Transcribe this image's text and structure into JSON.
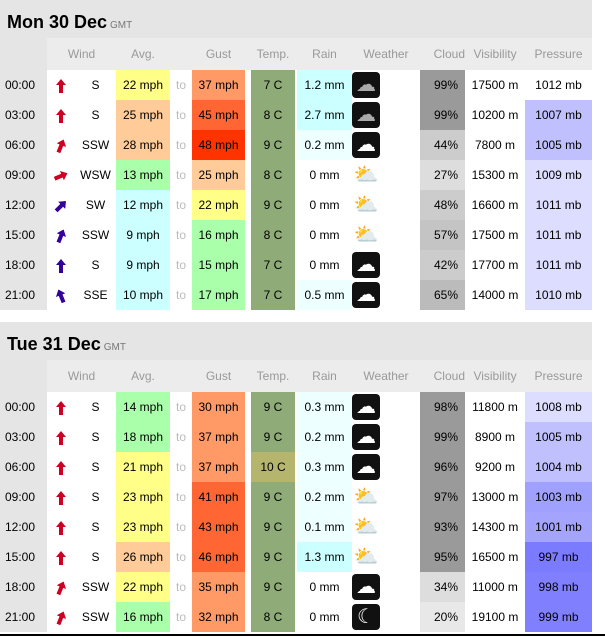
{
  "columns": {
    "wind": "Wind",
    "avg": "Avg.",
    "gust": "Gust",
    "temp": "Temp.",
    "rain": "Rain",
    "weather": "Weather",
    "cloud": "Cloud",
    "visibility": "Visibility",
    "pressure": "Pressure"
  },
  "to_label": "to",
  "days": [
    {
      "title": "Mon 30 Dec",
      "tz": "GMT",
      "rows": [
        {
          "time": "00:00",
          "dir": "S",
          "arrow_color": "#cc0022",
          "avg": "22 mph",
          "avg_color": "#ffff88",
          "gust": "37 mph",
          "gust_color": "#ff9966",
          "temp": "7 C",
          "temp_color": "#8fac78",
          "rain": "1.2 mm",
          "rain_color": "#ccffff",
          "weather": "cloud-rain-icon",
          "cloud": "99%",
          "cloud_color": "#9a9a9a",
          "vis": "17500 m",
          "pres": "1012 mb",
          "pres_color": "#ffffff"
        },
        {
          "time": "03:00",
          "dir": "S",
          "arrow_color": "#cc0022",
          "avg": "25 mph",
          "avg_color": "#ffcc99",
          "gust": "45 mph",
          "gust_color": "#ff6633",
          "temp": "8 C",
          "temp_color": "#8fac78",
          "rain": "2.7 mm",
          "rain_color": "#ccffff",
          "weather": "cloud-rain-icon",
          "cloud": "99%",
          "cloud_color": "#9a9a9a",
          "vis": "10200 m",
          "pres": "1007 mb",
          "pres_color": "#c0c0ff"
        },
        {
          "time": "06:00",
          "dir": "SSW",
          "arrow_color": "#cc0022",
          "avg": "28 mph",
          "avg_color": "#ffcc99",
          "gust": "48 mph",
          "gust_color": "#ff3300",
          "temp": "9 C",
          "temp_color": "#8fac78",
          "rain": "0.2 mm",
          "rain_color": "#eeffff",
          "weather": "cloud-night-icon",
          "cloud": "44%",
          "cloud_color": "#cccccc",
          "vis": "7800 m",
          "pres": "1005 mb",
          "pres_color": "#c0c0ff"
        },
        {
          "time": "09:00",
          "dir": "WSW",
          "arrow_color": "#cc0022",
          "avg": "13 mph",
          "avg_color": "#aaffaa",
          "gust": "25 mph",
          "gust_color": "#ffcc99",
          "temp": "8 C",
          "temp_color": "#8fac78",
          "rain": "0 mm",
          "rain_color": "#ffffff",
          "weather": "cloud-sun-icon",
          "cloud": "27%",
          "cloud_color": "#dddddd",
          "vis": "15300 m",
          "pres": "1009 mb",
          "pres_color": "#ddddff"
        },
        {
          "time": "12:00",
          "dir": "SW",
          "arrow_color": "#330099",
          "avg": "12 mph",
          "avg_color": "#ccffff",
          "gust": "22 mph",
          "gust_color": "#ffff88",
          "temp": "9 C",
          "temp_color": "#8fac78",
          "rain": "0 mm",
          "rain_color": "#ffffff",
          "weather": "cloud-sun-icon",
          "cloud": "48%",
          "cloud_color": "#cccccc",
          "vis": "16600 m",
          "pres": "1011 mb",
          "pres_color": "#ddddff"
        },
        {
          "time": "15:00",
          "dir": "SSW",
          "arrow_color": "#330099",
          "avg": "9 mph",
          "avg_color": "#ccffff",
          "gust": "16 mph",
          "gust_color": "#aaffaa",
          "temp": "8 C",
          "temp_color": "#8fac78",
          "rain": "0 mm",
          "rain_color": "#ffffff",
          "weather": "cloud-sun-icon",
          "cloud": "57%",
          "cloud_color": "#c4c4c4",
          "vis": "17500 m",
          "pres": "1011 mb",
          "pres_color": "#ddddff"
        },
        {
          "time": "18:00",
          "dir": "S",
          "arrow_color": "#330099",
          "avg": "9 mph",
          "avg_color": "#ccffff",
          "gust": "15 mph",
          "gust_color": "#aaffaa",
          "temp": "7 C",
          "temp_color": "#8fac78",
          "rain": "0 mm",
          "rain_color": "#ffffff",
          "weather": "cloud-night-icon",
          "cloud": "42%",
          "cloud_color": "#cccccc",
          "vis": "17700 m",
          "pres": "1011 mb",
          "pres_color": "#ddddff"
        },
        {
          "time": "21:00",
          "dir": "SSE",
          "arrow_color": "#330099",
          "avg": "10 mph",
          "avg_color": "#ccffff",
          "gust": "17 mph",
          "gust_color": "#aaffaa",
          "temp": "7 C",
          "temp_color": "#8fac78",
          "rain": "0.5 mm",
          "rain_color": "#eeffff",
          "weather": "cloud-night-icon",
          "cloud": "65%",
          "cloud_color": "#bbbbbb",
          "vis": "14000 m",
          "pres": "1010 mb",
          "pres_color": "#ddddff"
        }
      ]
    },
    {
      "title": "Tue 31 Dec",
      "tz": "GMT",
      "rows": [
        {
          "time": "00:00",
          "dir": "S",
          "arrow_color": "#cc0022",
          "avg": "14 mph",
          "avg_color": "#aaffaa",
          "gust": "30 mph",
          "gust_color": "#ff9966",
          "temp": "9 C",
          "temp_color": "#8fac78",
          "rain": "0.3 mm",
          "rain_color": "#eeffff",
          "weather": "cloud-night-icon",
          "cloud": "98%",
          "cloud_color": "#9a9a9a",
          "vis": "11800 m",
          "pres": "1008 mb",
          "pres_color": "#ddddff"
        },
        {
          "time": "03:00",
          "dir": "S",
          "arrow_color": "#cc0022",
          "avg": "18 mph",
          "avg_color": "#aaffaa",
          "gust": "37 mph",
          "gust_color": "#ff9966",
          "temp": "9 C",
          "temp_color": "#8fac78",
          "rain": "0.2 mm",
          "rain_color": "#eeffff",
          "weather": "cloud-night-icon",
          "cloud": "99%",
          "cloud_color": "#9a9a9a",
          "vis": "8900 m",
          "pres": "1005 mb",
          "pres_color": "#c0c0ff"
        },
        {
          "time": "06:00",
          "dir": "S",
          "arrow_color": "#cc0022",
          "avg": "21 mph",
          "avg_color": "#ffff88",
          "gust": "37 mph",
          "gust_color": "#ff9966",
          "temp": "10 C",
          "temp_color": "#b5b56e",
          "rain": "0.3 mm",
          "rain_color": "#eeffff",
          "weather": "cloud-night-icon",
          "cloud": "96%",
          "cloud_color": "#9a9a9a",
          "vis": "9200 m",
          "pres": "1004 mb",
          "pres_color": "#c0c0ff"
        },
        {
          "time": "09:00",
          "dir": "S",
          "arrow_color": "#cc0022",
          "avg": "23 mph",
          "avg_color": "#ffff88",
          "gust": "41 mph",
          "gust_color": "#ff6633",
          "temp": "9 C",
          "temp_color": "#8fac78",
          "rain": "0.2 mm",
          "rain_color": "#eeffff",
          "weather": "cloud-sun-icon",
          "cloud": "97%",
          "cloud_color": "#9a9a9a",
          "vis": "13000 m",
          "pres": "1003 mb",
          "pres_color": "#a0a0ff"
        },
        {
          "time": "12:00",
          "dir": "S",
          "arrow_color": "#cc0022",
          "avg": "23 mph",
          "avg_color": "#ffff88",
          "gust": "43 mph",
          "gust_color": "#ff6633",
          "temp": "9 C",
          "temp_color": "#8fac78",
          "rain": "0.1 mm",
          "rain_color": "#eeffff",
          "weather": "cloud-sun-icon",
          "cloud": "93%",
          "cloud_color": "#9a9a9a",
          "vis": "14300 m",
          "pres": "1001 mb",
          "pres_color": "#a4a4ff"
        },
        {
          "time": "15:00",
          "dir": "S",
          "arrow_color": "#cc0022",
          "avg": "26 mph",
          "avg_color": "#ffcc99",
          "gust": "46 mph",
          "gust_color": "#ff6633",
          "temp": "9 C",
          "temp_color": "#8fac78",
          "rain": "1.3 mm",
          "rain_color": "#ccffff",
          "weather": "cloud-sun-rain-icon",
          "cloud": "95%",
          "cloud_color": "#9a9a9a",
          "vis": "16500 m",
          "pres": "997 mb",
          "pres_color": "#7b7bff"
        },
        {
          "time": "18:00",
          "dir": "SSW",
          "arrow_color": "#cc0022",
          "avg": "22 mph",
          "avg_color": "#ffff88",
          "gust": "35 mph",
          "gust_color": "#ff9966",
          "temp": "9 C",
          "temp_color": "#8fac78",
          "rain": "0 mm",
          "rain_color": "#ffffff",
          "weather": "cloud-night-icon",
          "cloud": "34%",
          "cloud_color": "#dddddd",
          "vis": "11000 m",
          "pres": "998 mb",
          "pres_color": "#8080ff"
        },
        {
          "time": "21:00",
          "dir": "SSW",
          "arrow_color": "#cc0022",
          "avg": "16 mph",
          "avg_color": "#aaffaa",
          "gust": "32 mph",
          "gust_color": "#ff9966",
          "temp": "8 C",
          "temp_color": "#8fac78",
          "rain": "0 mm",
          "rain_color": "#ffffff",
          "weather": "moon-icon",
          "cloud": "20%",
          "cloud_color": "#e8e8e8",
          "vis": "19100 m",
          "pres": "999 mb",
          "pres_color": "#8080ff"
        }
      ]
    }
  ]
}
